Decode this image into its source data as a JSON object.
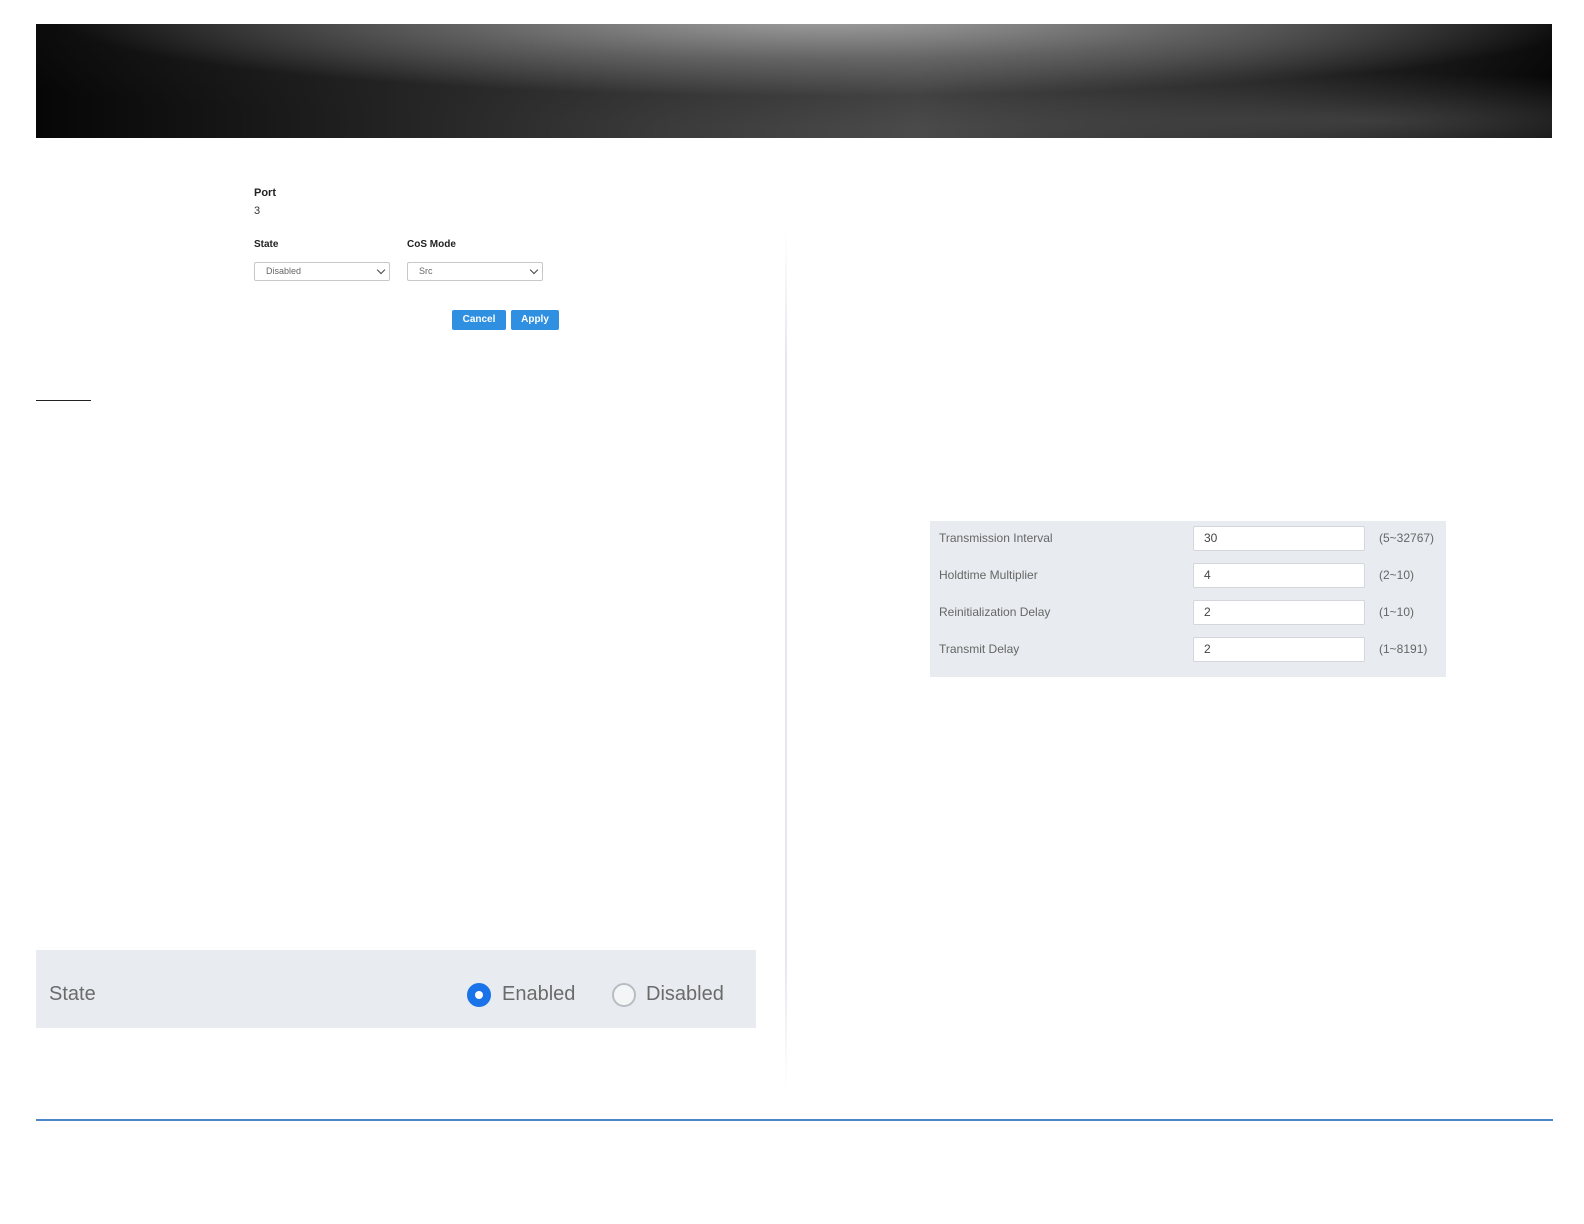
{
  "port_form": {
    "port_label": "Port",
    "port_value": "3",
    "state_label": "State",
    "state_selected": "Disabled",
    "cos_mode_label": "CoS Mode",
    "cos_mode_selected": "Src",
    "cancel_label": "Cancel",
    "apply_label": "Apply"
  },
  "state_panel": {
    "label": "State",
    "options": [
      "Enabled",
      "Disabled"
    ],
    "selected": "Enabled"
  },
  "lldp_config": {
    "rows": [
      {
        "label": "Transmission Interval",
        "value": "30",
        "range": "(5~32767)"
      },
      {
        "label": "Holdtime Multiplier",
        "value": "4",
        "range": "(2~10)"
      },
      {
        "label": "Reinitialization Delay",
        "value": "2",
        "range": "(1~10)"
      },
      {
        "label": "Transmit Delay",
        "value": "2",
        "range": "(1~8191)"
      }
    ]
  },
  "colors": {
    "button_blue": "#2f8fe0",
    "radio_selected": "#1a73e8",
    "panel_bg": "#e8ebef",
    "footer_rule": "#4a86c8"
  }
}
